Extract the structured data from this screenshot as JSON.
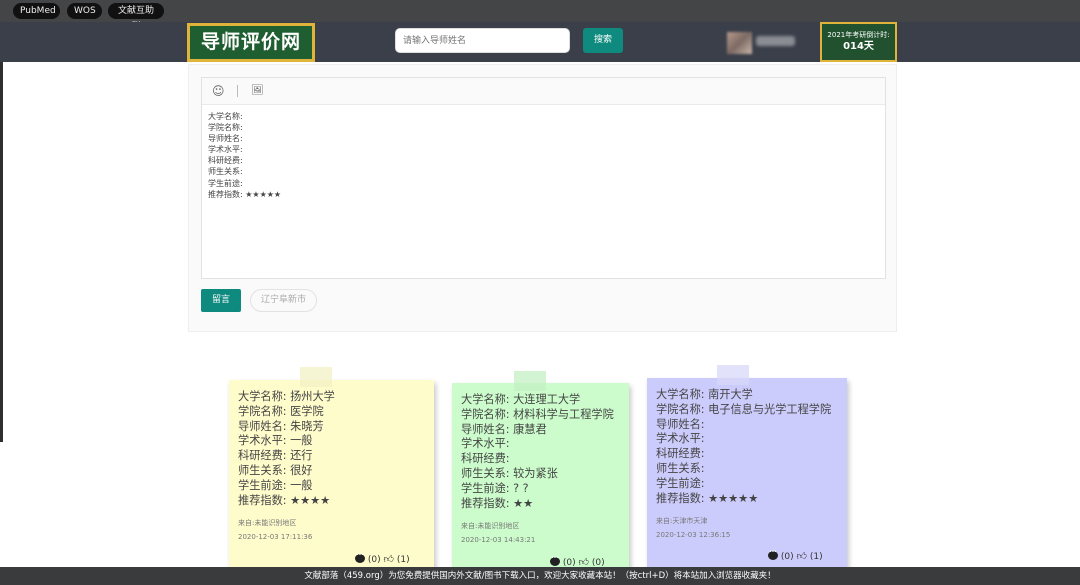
{
  "bookmarks": [
    "PubMed",
    "WOS",
    "文献互助群"
  ],
  "header": {
    "logo": "导师评价网",
    "search_placeholder": "请输入导师姓名",
    "search_button": "搜索",
    "countdown_label": "2021年考研倒计时:",
    "countdown_value": "014天"
  },
  "editor": {
    "emoji_icon": "☺",
    "image_icon": "🖼",
    "template_lines": [
      "大学名称:",
      "学院名称:",
      "导师姓名:",
      "学术水平:",
      "科研经费:",
      "师生关系:",
      "学生前途:",
      "推荐指数: ★★★★★"
    ],
    "submit_button": "留言",
    "region": "辽宁阜新市"
  },
  "notes": [
    {
      "lines": [
        "大学名称:  扬州大学",
        "学院名称:  医学院",
        "导师姓名:  朱晓芳",
        "学术水平: 一般",
        "科研经费:  还行",
        "师生关系:  很好",
        "学生前途:  一般",
        "推荐指数: ★★★★"
      ],
      "from": "来自:未能识别地区",
      "date": "2020-12-03  17:11:36",
      "comments": "(0)",
      "likes": "(1)"
    },
    {
      "lines": [
        "大学名称:  大连理工大学",
        "学院名称:  材料科学与工程学院",
        "导师姓名:  康慧君",
        "学术水平:",
        "科研经费:",
        "师生关系:  较为紧张",
        "学生前途: ? ?",
        "推荐指数: ★★"
      ],
      "from": "来自:未能识别地区",
      "date": "2020-12-03  14:43:21",
      "comments": "(0)",
      "likes": "(0)"
    },
    {
      "lines": [
        "大学名称:  南开大学",
        "学院名称:  电子信息与光学工程学院",
        "导师姓名:",
        "学术水平:",
        "科研经费:",
        "师生关系:",
        "学生前途:",
        "推荐指数: ★★★★★"
      ],
      "from": "来自:天津市天津",
      "date": "2020-12-03  12:36:15",
      "comments": "(0)",
      "likes": "(1)"
    }
  ],
  "footer": "文献部落（459.org）为您免费提供国内外文献/图书下载入口，欢迎大家收藏本站！（按ctrl+D）将本站加入浏览器收藏夹！"
}
